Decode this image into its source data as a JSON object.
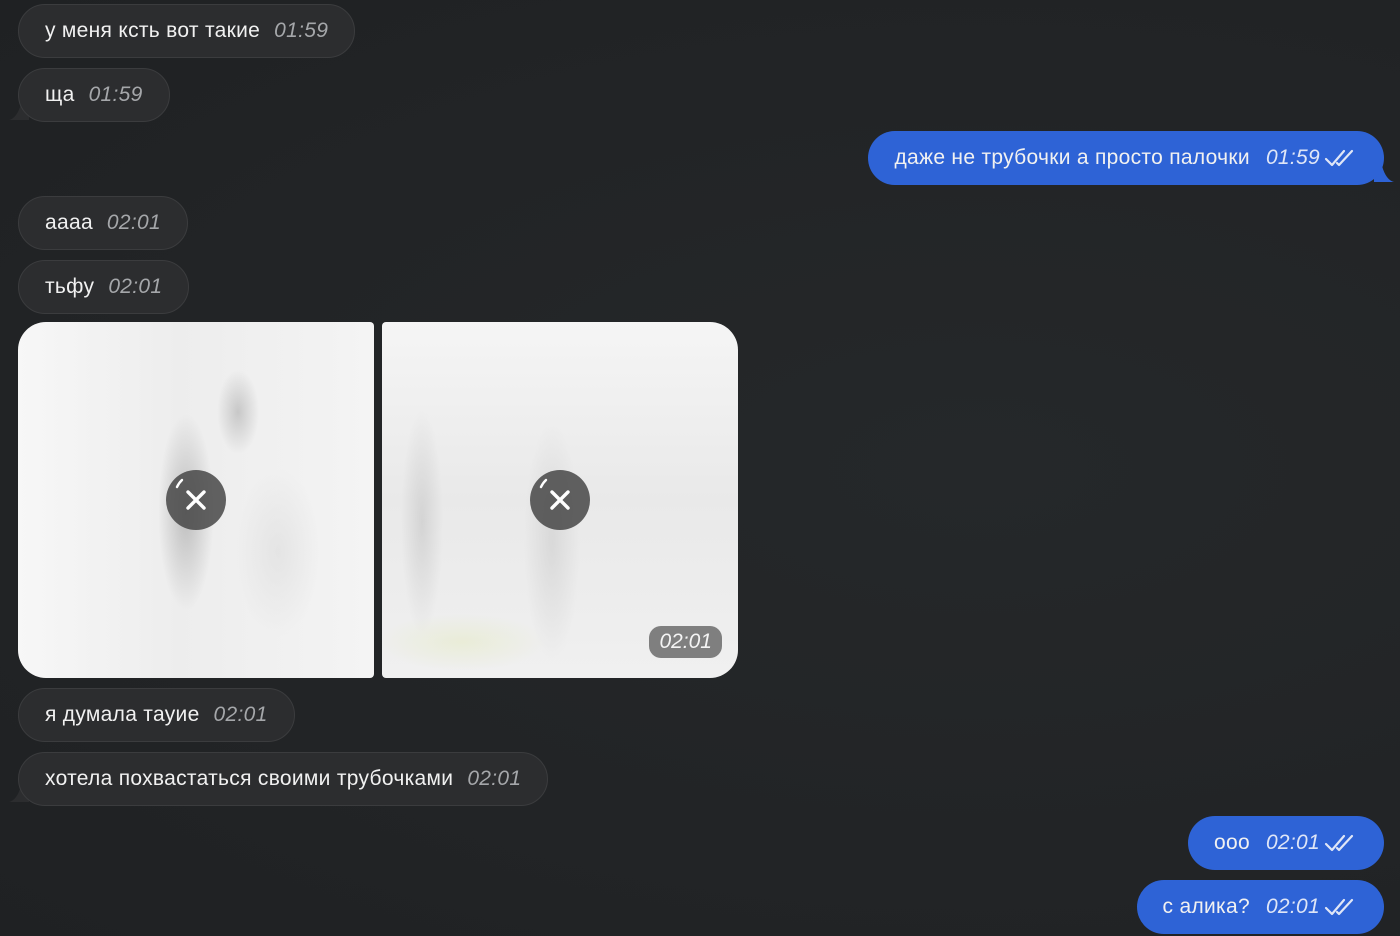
{
  "messages": [
    {
      "text": "у меня ксть вот такие",
      "time": "01:59"
    },
    {
      "text": "ща",
      "time": "01:59"
    },
    {
      "text": "даже не трубочки а просто палочки",
      "time": "01:59"
    },
    {
      "text": "аааа",
      "time": "02:01"
    },
    {
      "text": "тьфу",
      "time": "02:01"
    },
    {
      "text": "я думала тауие",
      "time": "02:01"
    },
    {
      "text": "хотела похвастаться своими трубочками",
      "time": "02:01"
    },
    {
      "text": "ооо",
      "time": "02:01"
    },
    {
      "text": "с алика?",
      "time": "02:01"
    }
  ],
  "album": {
    "time": "02:01"
  },
  "colors": {
    "background": "#222426",
    "incoming_bubble": "#2c2d2f",
    "outgoing_bubble": "#2e63d6"
  },
  "icons": {
    "read_receipt": "double-check-icon",
    "download_cancel": "close-icon"
  }
}
